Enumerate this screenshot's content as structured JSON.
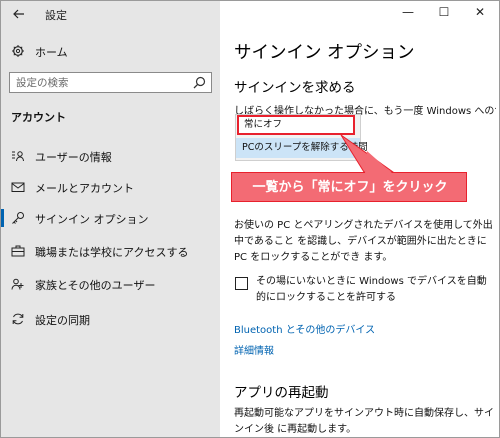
{
  "window": {
    "title": "設定",
    "back_icon": "arrow-left-icon",
    "controls": {
      "minimize": "—",
      "maximize": "☐",
      "close": "✕"
    }
  },
  "sidebar": {
    "home_label": "ホーム",
    "search_placeholder": "設定の検索",
    "section_title": "アカウント",
    "items": [
      {
        "label": "ユーザーの情報",
        "icon": "person-card-icon",
        "active": false
      },
      {
        "label": "メールとアカウント",
        "icon": "mail-icon",
        "active": false
      },
      {
        "label": "サインイン オプション",
        "icon": "key-icon",
        "active": true
      },
      {
        "label": "職場または学校にアクセスする",
        "icon": "briefcase-icon",
        "active": false
      },
      {
        "label": "家族とその他のユーザー",
        "icon": "people-icon",
        "active": false
      },
      {
        "label": "設定の同期",
        "icon": "sync-icon",
        "active": false
      }
    ]
  },
  "main": {
    "page_title": "サインイン オプション",
    "require_signin_heading": "サインインを求める",
    "require_signin_desc": "しばらく操作しなかった場合に、もう一度 Windows へのサインイン",
    "dropdown": {
      "selected": "常にオフ",
      "options": [
        "常にオフ",
        "PCのスリープを解除する時間"
      ]
    },
    "dynamic_lock_desc": "お使いの PC とペアリングされたデバイスを使用して外出中であること を認識し、デバイスが範囲外に出たときに PC をロックすることができ ます。",
    "dynamic_lock_checkbox": "その場にいないときに Windows でデバイスを自動的にロックすることを許可する",
    "bluetooth_link": "Bluetooth とその他のデバイス",
    "details_link": "詳細情報",
    "app_restart_heading": "アプリの再起動",
    "app_restart_desc": "再起動可能なアプリをサインアウト時に自動保存し、サインイン後 に再起動します。"
  },
  "annotation": {
    "callout_text": "一覧から「常にオフ」をクリック",
    "highlight_color": "#e8212d",
    "callout_fill": "#f36b74"
  },
  "colors": {
    "sidebar_bg": "#e6e6e6",
    "accent": "#0063b1",
    "selection_bg": "#cce4f7"
  }
}
